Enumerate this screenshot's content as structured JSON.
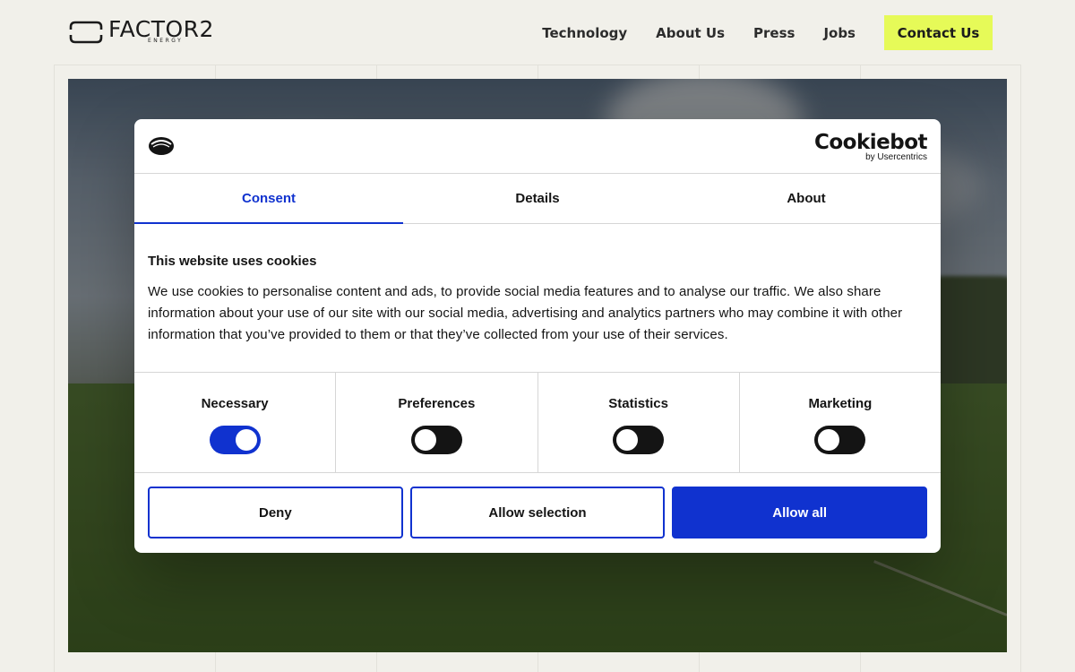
{
  "header": {
    "logo_word": "FACTOR2",
    "logo_sub": "ENERGY",
    "nav": [
      {
        "label": "Technology"
      },
      {
        "label": "About Us"
      },
      {
        "label": "Press"
      },
      {
        "label": "Jobs"
      }
    ],
    "contact_label": "Contact Us"
  },
  "colors": {
    "accent_yellow": "#e6fa58",
    "cookie_blue": "#1032cf",
    "page_bg": "#f1f0ea"
  },
  "dialog": {
    "provider": "Cookiebot",
    "provider_sub": "by Usercentrics",
    "tabs": [
      {
        "label": "Consent",
        "active": true
      },
      {
        "label": "Details",
        "active": false
      },
      {
        "label": "About",
        "active": false
      }
    ],
    "title": "This website uses cookies",
    "description": "We use cookies to personalise content and ads, to provide social media features and to analyse our traffic. We also share information about your use of our site with our social media, advertising and analytics partners who may combine it with other information that you’ve provided to them or that they’ve collected from your use of their services.",
    "toggles": [
      {
        "label": "Necessary",
        "on": true
      },
      {
        "label": "Preferences",
        "on": false
      },
      {
        "label": "Statistics",
        "on": false
      },
      {
        "label": "Marketing",
        "on": false
      }
    ],
    "buttons": {
      "deny": "Deny",
      "allow_selection": "Allow selection",
      "allow_all": "Allow all"
    }
  }
}
